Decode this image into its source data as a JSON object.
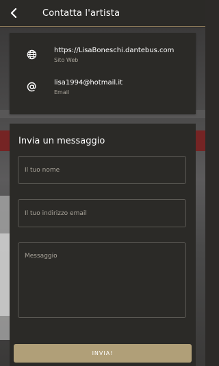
{
  "header": {
    "title": "Contatta l'artista"
  },
  "contacts": [
    {
      "value": "https://LisaBoneschi.dantebus.com",
      "label": "Sito Web",
      "icon": "globe-icon"
    },
    {
      "value": "lisa1994@hotmail.it",
      "label": "Email",
      "icon": "at-icon"
    }
  ],
  "form": {
    "title": "Invia un messaggio",
    "name_placeholder": "Il tuo nome",
    "email_placeholder": "Il tuo indirizzo email",
    "message_placeholder": "Messaggio",
    "submit_label": "INVIA!"
  },
  "colors": {
    "accent": "#b09f78",
    "panel": "#2b2a27",
    "muted_text": "#a9a49a"
  }
}
